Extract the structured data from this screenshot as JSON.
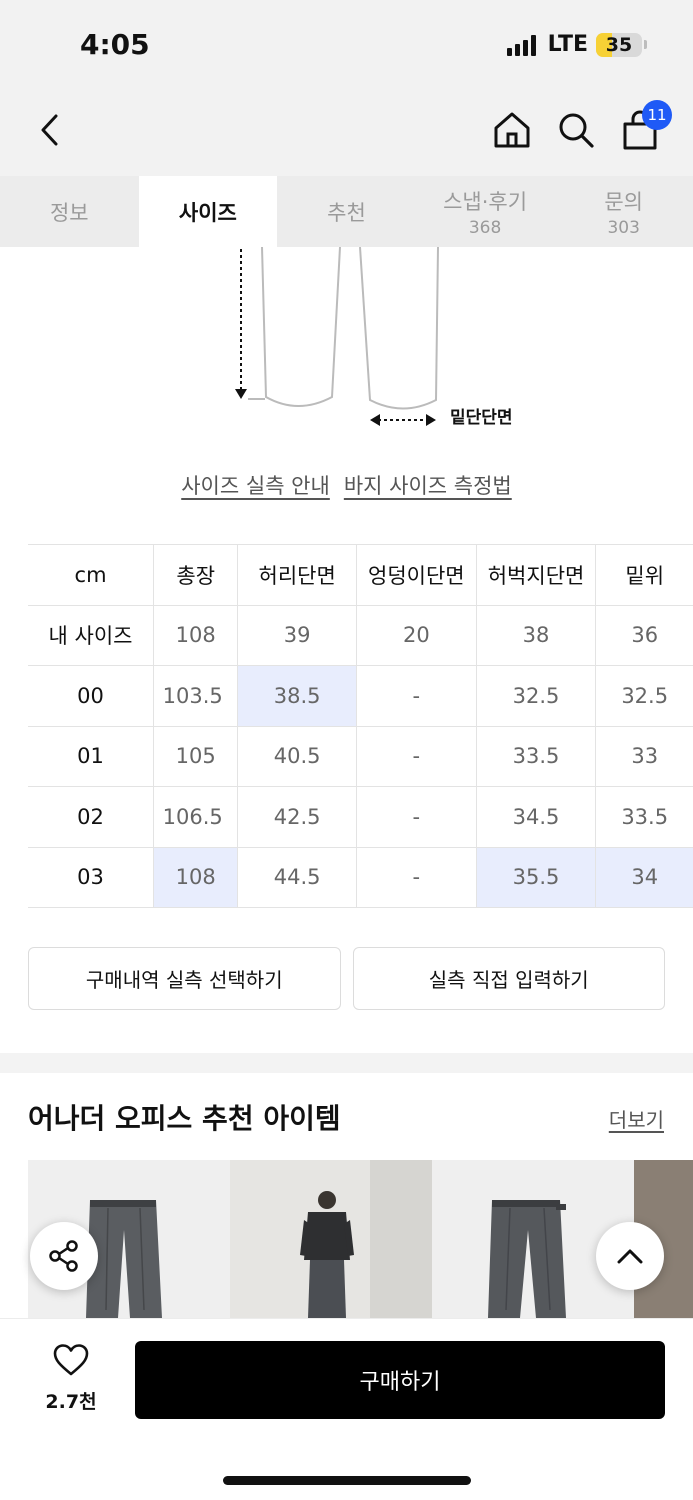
{
  "status_bar": {
    "time": "4:05",
    "network": "LTE",
    "battery": "35",
    "battery_level": 0.35
  },
  "nav": {
    "cart_badge": "11"
  },
  "tabs": [
    {
      "label": "정보",
      "count": ""
    },
    {
      "label": "사이즈",
      "count": ""
    },
    {
      "label": "추천",
      "count": ""
    },
    {
      "label": "스냅·후기",
      "count": "368"
    },
    {
      "label": "문의",
      "count": "303"
    }
  ],
  "active_tab": "사이즈",
  "diagram": {
    "hem_label": "밑단단면"
  },
  "links": {
    "size_guide": "사이즈 실측 안내",
    "measure_method": "바지 사이즈 측정법"
  },
  "size_table": {
    "unit": "cm",
    "columns": [
      "총장",
      "허리단면",
      "엉덩이단면",
      "허벅지단면",
      "밑위"
    ],
    "rows": [
      {
        "label": "내 사이즈",
        "values": [
          "108",
          "39",
          "20",
          "38",
          "36"
        ]
      },
      {
        "label": "00",
        "values": [
          "103.5",
          "38.5",
          "-",
          "32.5",
          "32.5"
        ]
      },
      {
        "label": "01",
        "values": [
          "105",
          "40.5",
          "-",
          "33.5",
          "33"
        ]
      },
      {
        "label": "02",
        "values": [
          "106.5",
          "42.5",
          "-",
          "34.5",
          "33.5"
        ]
      },
      {
        "label": "03",
        "values": [
          "108",
          "44.5",
          "-",
          "35.5",
          "34"
        ]
      }
    ],
    "highlight_color": "#e8edfd"
  },
  "buttons": {
    "purchase_history": "구매내역 실측 선택하기",
    "direct_input": "실측 직접 입력하기"
  },
  "recommend": {
    "title": "어나더 오피스 추천 아이템",
    "more": "더보기"
  },
  "bottom": {
    "like_count": "2.7천",
    "buy": "구매하기"
  },
  "colors": {
    "accent_blue": "#1f5af6",
    "buy_button": "#000000",
    "tab_bar": "#ececec"
  }
}
